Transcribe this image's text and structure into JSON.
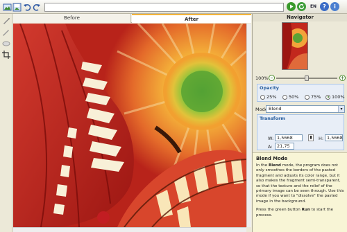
{
  "toolbar": {
    "path_value": "",
    "language": "EN"
  },
  "tabs": [
    {
      "label": "Before"
    },
    {
      "label": "After"
    }
  ],
  "navigator": {
    "title": "Navigator"
  },
  "zoom": {
    "label": "100%",
    "level_fraction": 0.5
  },
  "opacity": {
    "title": "Opacity",
    "options": [
      "25%",
      "50%",
      "75%",
      "100%"
    ],
    "selected": "100%"
  },
  "mode": {
    "label": "Mode",
    "value": "Blend"
  },
  "transform": {
    "title": "Transform",
    "w_label": "W:",
    "w_value": "1,5668",
    "h_label": "H:",
    "h_value": "1,5668",
    "a_label": "A:",
    "a_value": "21,75"
  },
  "help": {
    "title": "Blend Mode",
    "text_parts": [
      {
        "t": "In the ",
        "b": false
      },
      {
        "t": "Blend",
        "b": true
      },
      {
        "t": " mode, the program does not only smoothes the borders of the pasted fragment and adjusts its color range, but it also makes the fragment semi-transparent, so that the texture and the relief of the primary image can be seen through. Use this mode if you want to \"dissolve\" the pasted image in the background.",
        "b": false
      }
    ],
    "run_parts": [
      {
        "t": "Press the green button ",
        "b": false
      },
      {
        "t": "Run",
        "b": true
      },
      {
        "t": " to start the process.",
        "b": false
      }
    ]
  },
  "colors": {
    "accent_green": "#3a9a2c",
    "accent_blue": "#3a6cc6",
    "tab_highlight": "#f2b33a",
    "help_background": "#f8f5d6"
  }
}
